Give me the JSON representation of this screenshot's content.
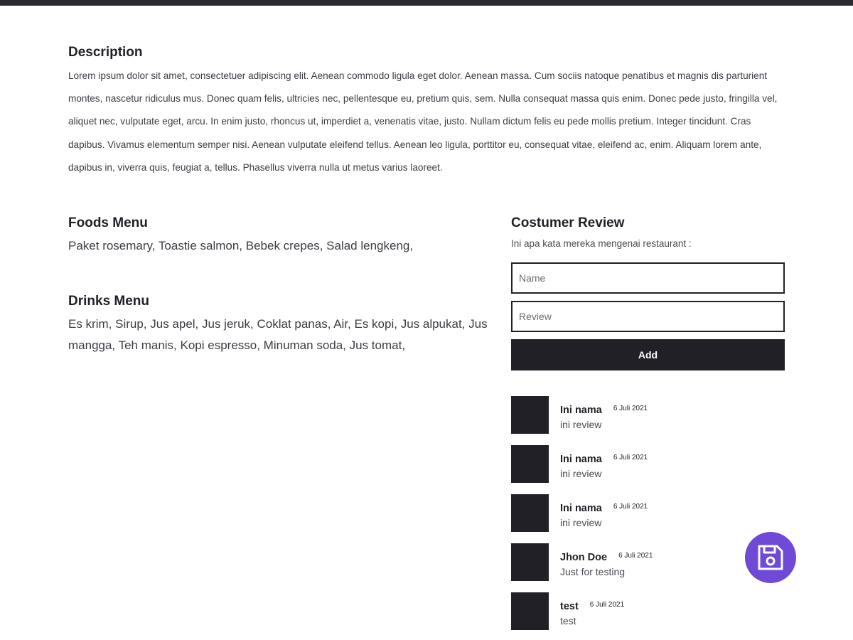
{
  "description": {
    "title": "Description",
    "text": "Lorem ipsum dolor sit amet, consectetuer adipiscing elit. Aenean commodo ligula eget dolor. Aenean massa. Cum sociis natoque penatibus et magnis dis parturient montes, nascetur ridiculus mus. Donec quam felis, ultricies nec, pellentesque eu, pretium quis, sem. Nulla consequat massa quis enim. Donec pede justo, fringilla vel, aliquet nec, vulputate eget, arcu. In enim justo, rhoncus ut, imperdiet a, venenatis vitae, justo. Nullam dictum felis eu pede mollis pretium. Integer tincidunt. Cras dapibus. Vivamus elementum semper nisi. Aenean vulputate eleifend tellus. Aenean leo ligula, porttitor eu, consequat vitae, eleifend ac, enim. Aliquam lorem ante, dapibus in, viverra quis, feugiat a, tellus. Phasellus viverra nulla ut metus varius laoreet."
  },
  "foods_menu": {
    "title": "Foods Menu",
    "text": "Paket rosemary, Toastie salmon, Bebek crepes, Salad lengkeng,"
  },
  "drinks_menu": {
    "title": "Drinks Menu",
    "text": "Es krim, Sirup, Jus apel, Jus jeruk, Coklat panas, Air, Es kopi, Jus alpukat, Jus mangga, Teh manis, Kopi espresso, Minuman soda, Jus tomat,"
  },
  "review_form": {
    "title": "Costumer Review",
    "subtitle": "Ini apa kata mereka mengenai restaurant :",
    "name_placeholder": "Name",
    "name_value": "",
    "review_placeholder": "Review",
    "review_value": "",
    "add_label": "Add"
  },
  "reviews": [
    {
      "name": "Ini nama",
      "date": "6 Juli 2021",
      "review": "ini review"
    },
    {
      "name": "Ini nama",
      "date": "6 Juli 2021",
      "review": "ini review"
    },
    {
      "name": "Ini nama",
      "date": "6 Juli 2021",
      "review": "ini review"
    },
    {
      "name": "Jhon Doe",
      "date": "6 Juli 2021",
      "review": "Just for testing"
    },
    {
      "name": "test",
      "date": "6 Juli 2021",
      "review": "test"
    }
  ],
  "fab": {
    "icon": "save-icon",
    "color": "#6f4ad6"
  },
  "colors": {
    "primary_dark": "#222027",
    "accent": "#6f4ad6",
    "background": "#ffffff"
  }
}
